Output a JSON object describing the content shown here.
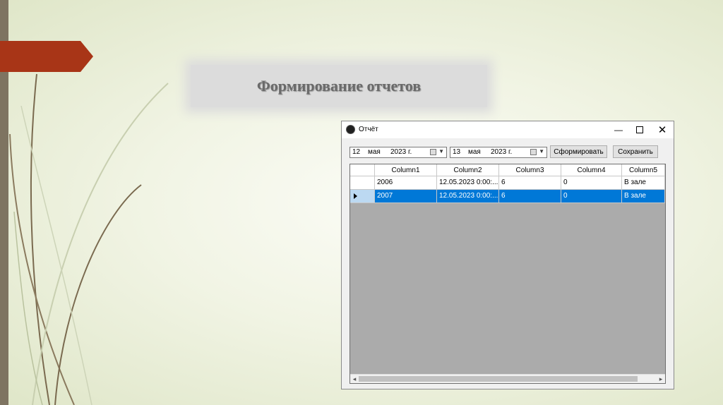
{
  "slide": {
    "title": "Формирование отчетов"
  },
  "window": {
    "title": "Отчёт",
    "controls": {
      "minimize": "—",
      "close": "✕"
    },
    "date_from": {
      "day": "12",
      "month": "мая",
      "year": "2023 г."
    },
    "date_to": {
      "day": "13",
      "month": "мая",
      "year": "2023 г."
    },
    "buttons": {
      "generate": "Сформировать",
      "save": "Сохранить"
    },
    "grid": {
      "columns": [
        "Column1",
        "Column2",
        "Column3",
        "Column4",
        "Column5"
      ],
      "rows": [
        [
          "2006",
          "12.05.2023 0:00:...",
          "6",
          "0",
          "В зале"
        ],
        [
          "2007",
          "12.05.2023 0:00:...",
          "6",
          "0",
          "В зале"
        ]
      ],
      "selected_row": 1,
      "scroll_left": "◂",
      "scroll_right": "▸"
    }
  },
  "colors": {
    "accent": "#a83517",
    "selection": "#0078d7",
    "sidebar": "#7e7461"
  }
}
